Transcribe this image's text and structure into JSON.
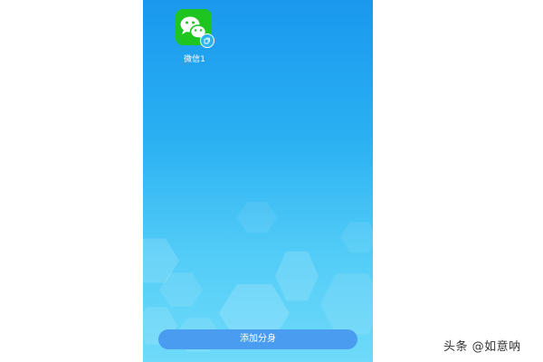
{
  "app_grid": {
    "apps": [
      {
        "label": "微信1",
        "icon": "wechat-icon",
        "badge": "clone-badge-icon"
      }
    ]
  },
  "footer": {
    "add_button_label": "添加分身"
  },
  "watermark": {
    "text": "头条 @如意呐"
  },
  "colors": {
    "gradient_top": "#1a98ee",
    "gradient_bottom": "#6fdaf9",
    "icon_green": "#1ec41f",
    "button_blue": "#4a9cf0"
  }
}
